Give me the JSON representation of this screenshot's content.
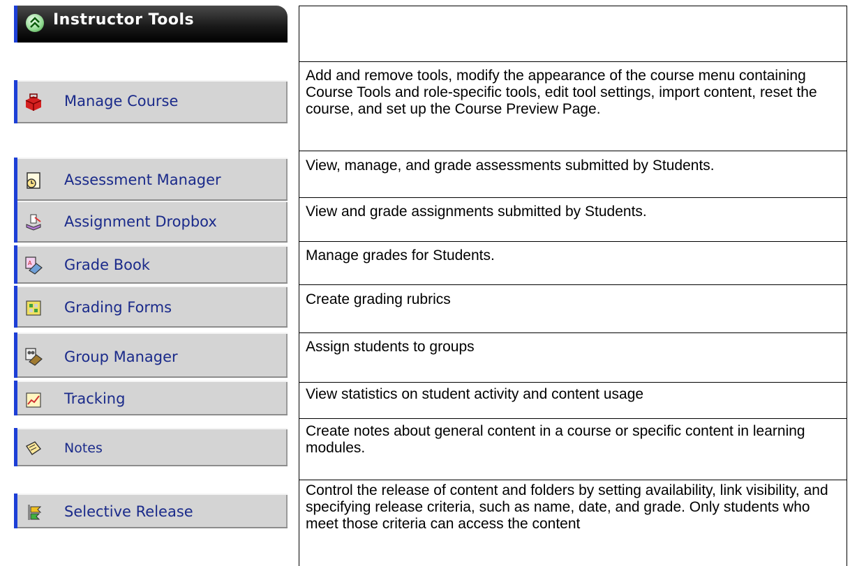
{
  "header": {
    "title": "Instructor Tools"
  },
  "tools": [
    {
      "icon": "manage-course-icon",
      "label": "Manage Course",
      "description": "Add and remove tools, modify the appearance of the course menu containing Course Tools and role-specific tools, edit tool settings, import content, reset the course, and set up the Course Preview Page."
    },
    {
      "icon": "assessment-manager-icon",
      "label": "Assessment Manager",
      "description": "View, manage, and grade assessments submitted by Students."
    },
    {
      "icon": "assignment-dropbox-icon",
      "label": "Assignment Dropbox",
      "description": "View and grade assignments submitted by Students."
    },
    {
      "icon": "grade-book-icon",
      "label": "Grade Book",
      "description": "Manage grades for Students."
    },
    {
      "icon": "grading-forms-icon",
      "label": "Grading Forms",
      "description": "Create grading rubrics"
    },
    {
      "icon": "group-manager-icon",
      "label": "Group Manager",
      "description": "Assign students to groups"
    },
    {
      "icon": "tracking-icon",
      "label": "Tracking",
      "description": "View statistics on student activity and content usage"
    },
    {
      "icon": "notes-icon",
      "label": "Notes",
      "description": "Create notes about general content in a course or specific content in learning modules."
    },
    {
      "icon": "selective-release-icon",
      "label": "Selective Release",
      "description": "Control the release of content and folders by setting availability, link visibility, and specifying release criteria, such as name, date, and grade. Only students who meet those criteria can access the content"
    }
  ]
}
